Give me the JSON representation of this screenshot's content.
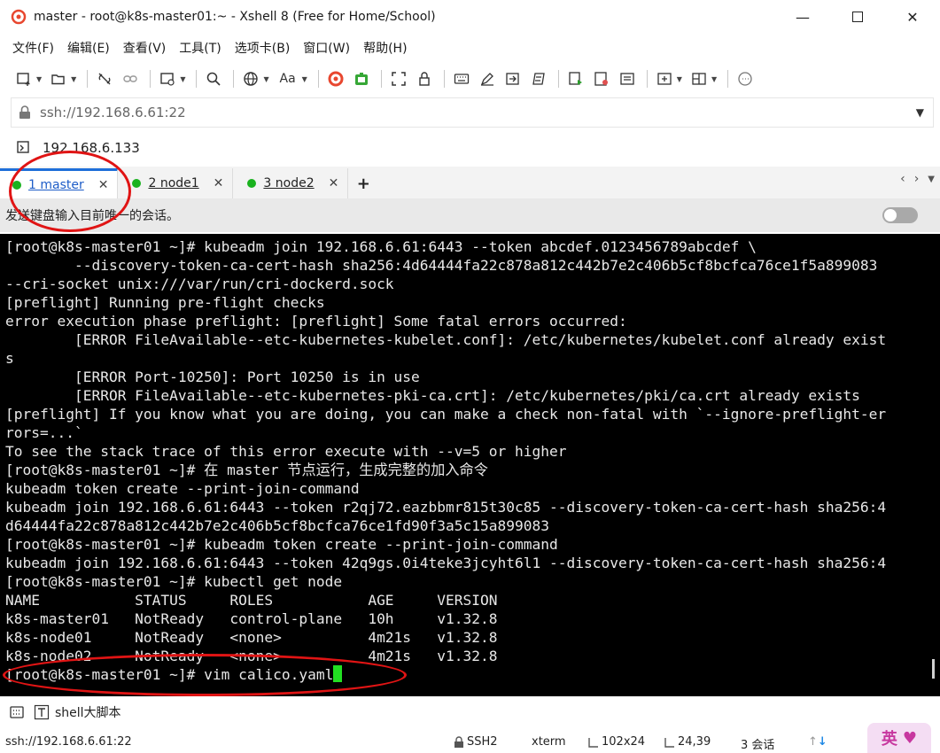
{
  "window": {
    "title": "master - root@k8s-master01:~ - Xshell 8 (Free for Home/School)"
  },
  "menu": [
    {
      "label": "文件(F)"
    },
    {
      "label": "编辑(E)"
    },
    {
      "label": "查看(V)"
    },
    {
      "label": "工具(T)"
    },
    {
      "label": "选项卡(B)"
    },
    {
      "label": "窗口(W)"
    },
    {
      "label": "帮助(H)"
    }
  ],
  "toolbar": {
    "font_label": "Aa"
  },
  "address": {
    "value": "ssh://192.168.6.61:22"
  },
  "session": {
    "label": "192.168.6.133"
  },
  "tabs": [
    {
      "label": "1 master",
      "active": true
    },
    {
      "label": "2 node1",
      "active": false
    },
    {
      "label": "3 node2",
      "active": false
    }
  ],
  "infobar": {
    "text": "发送键盘输入目前唯一的会话。"
  },
  "terminal": {
    "lines": [
      "[root@k8s-master01 ~]# kubeadm join 192.168.6.61:6443 --token abcdef.0123456789abcdef \\",
      "        --discovery-token-ca-cert-hash sha256:4d64444fa22c878a812c442b7e2c406b5cf8bcfca76ce1f5a899083",
      "--cri-socket unix:///var/run/cri-dockerd.sock",
      "[preflight] Running pre-flight checks",
      "error execution phase preflight: [preflight] Some fatal errors occurred:",
      "        [ERROR FileAvailable--etc-kubernetes-kubelet.conf]: /etc/kubernetes/kubelet.conf already exist",
      "s",
      "        [ERROR Port-10250]: Port 10250 is in use",
      "        [ERROR FileAvailable--etc-kubernetes-pki-ca.crt]: /etc/kubernetes/pki/ca.crt already exists",
      "[preflight] If you know what you are doing, you can make a check non-fatal with `--ignore-preflight-er",
      "rors=...`",
      "To see the stack trace of this error execute with --v=5 or higher",
      "[root@k8s-master01 ~]# 在 master 节点运行，生成完整的加入命令",
      "kubeadm token create --print-join-command",
      "kubeadm join 192.168.6.61:6443 --token r2qj72.eazbbmr815t30c85 --discovery-token-ca-cert-hash sha256:4",
      "d64444fa22c878a812c442b7e2c406b5cf8bcfca76ce1fd90f3a5c15a899083",
      "[root@k8s-master01 ~]# kubeadm token create --print-join-command",
      "kubeadm join 192.168.6.61:6443 --token 42q9gs.0i4teke3jcyht6l1 --discovery-token-ca-cert-hash sha256:4",
      "[root@k8s-master01 ~]# kubectl get node",
      "NAME           STATUS     ROLES           AGE     VERSION",
      "k8s-master01   NotReady   control-plane   10h     v1.32.8",
      "k8s-node01     NotReady   <none>          4m21s   v1.32.8",
      "k8s-node02     NotReady   <none>          4m21s   v1.32.8"
    ],
    "prompt_line": "[root@k8s-master01 ~]# vim calico.yaml"
  },
  "compose": {
    "label": "shell大脚本"
  },
  "status": {
    "address": "ssh://192.168.6.61:22",
    "protocol": "SSH2",
    "term": "xterm",
    "size": "102x24",
    "cursor": "24,39",
    "sessions": "3 会话"
  },
  "ime": {
    "label": "英"
  }
}
